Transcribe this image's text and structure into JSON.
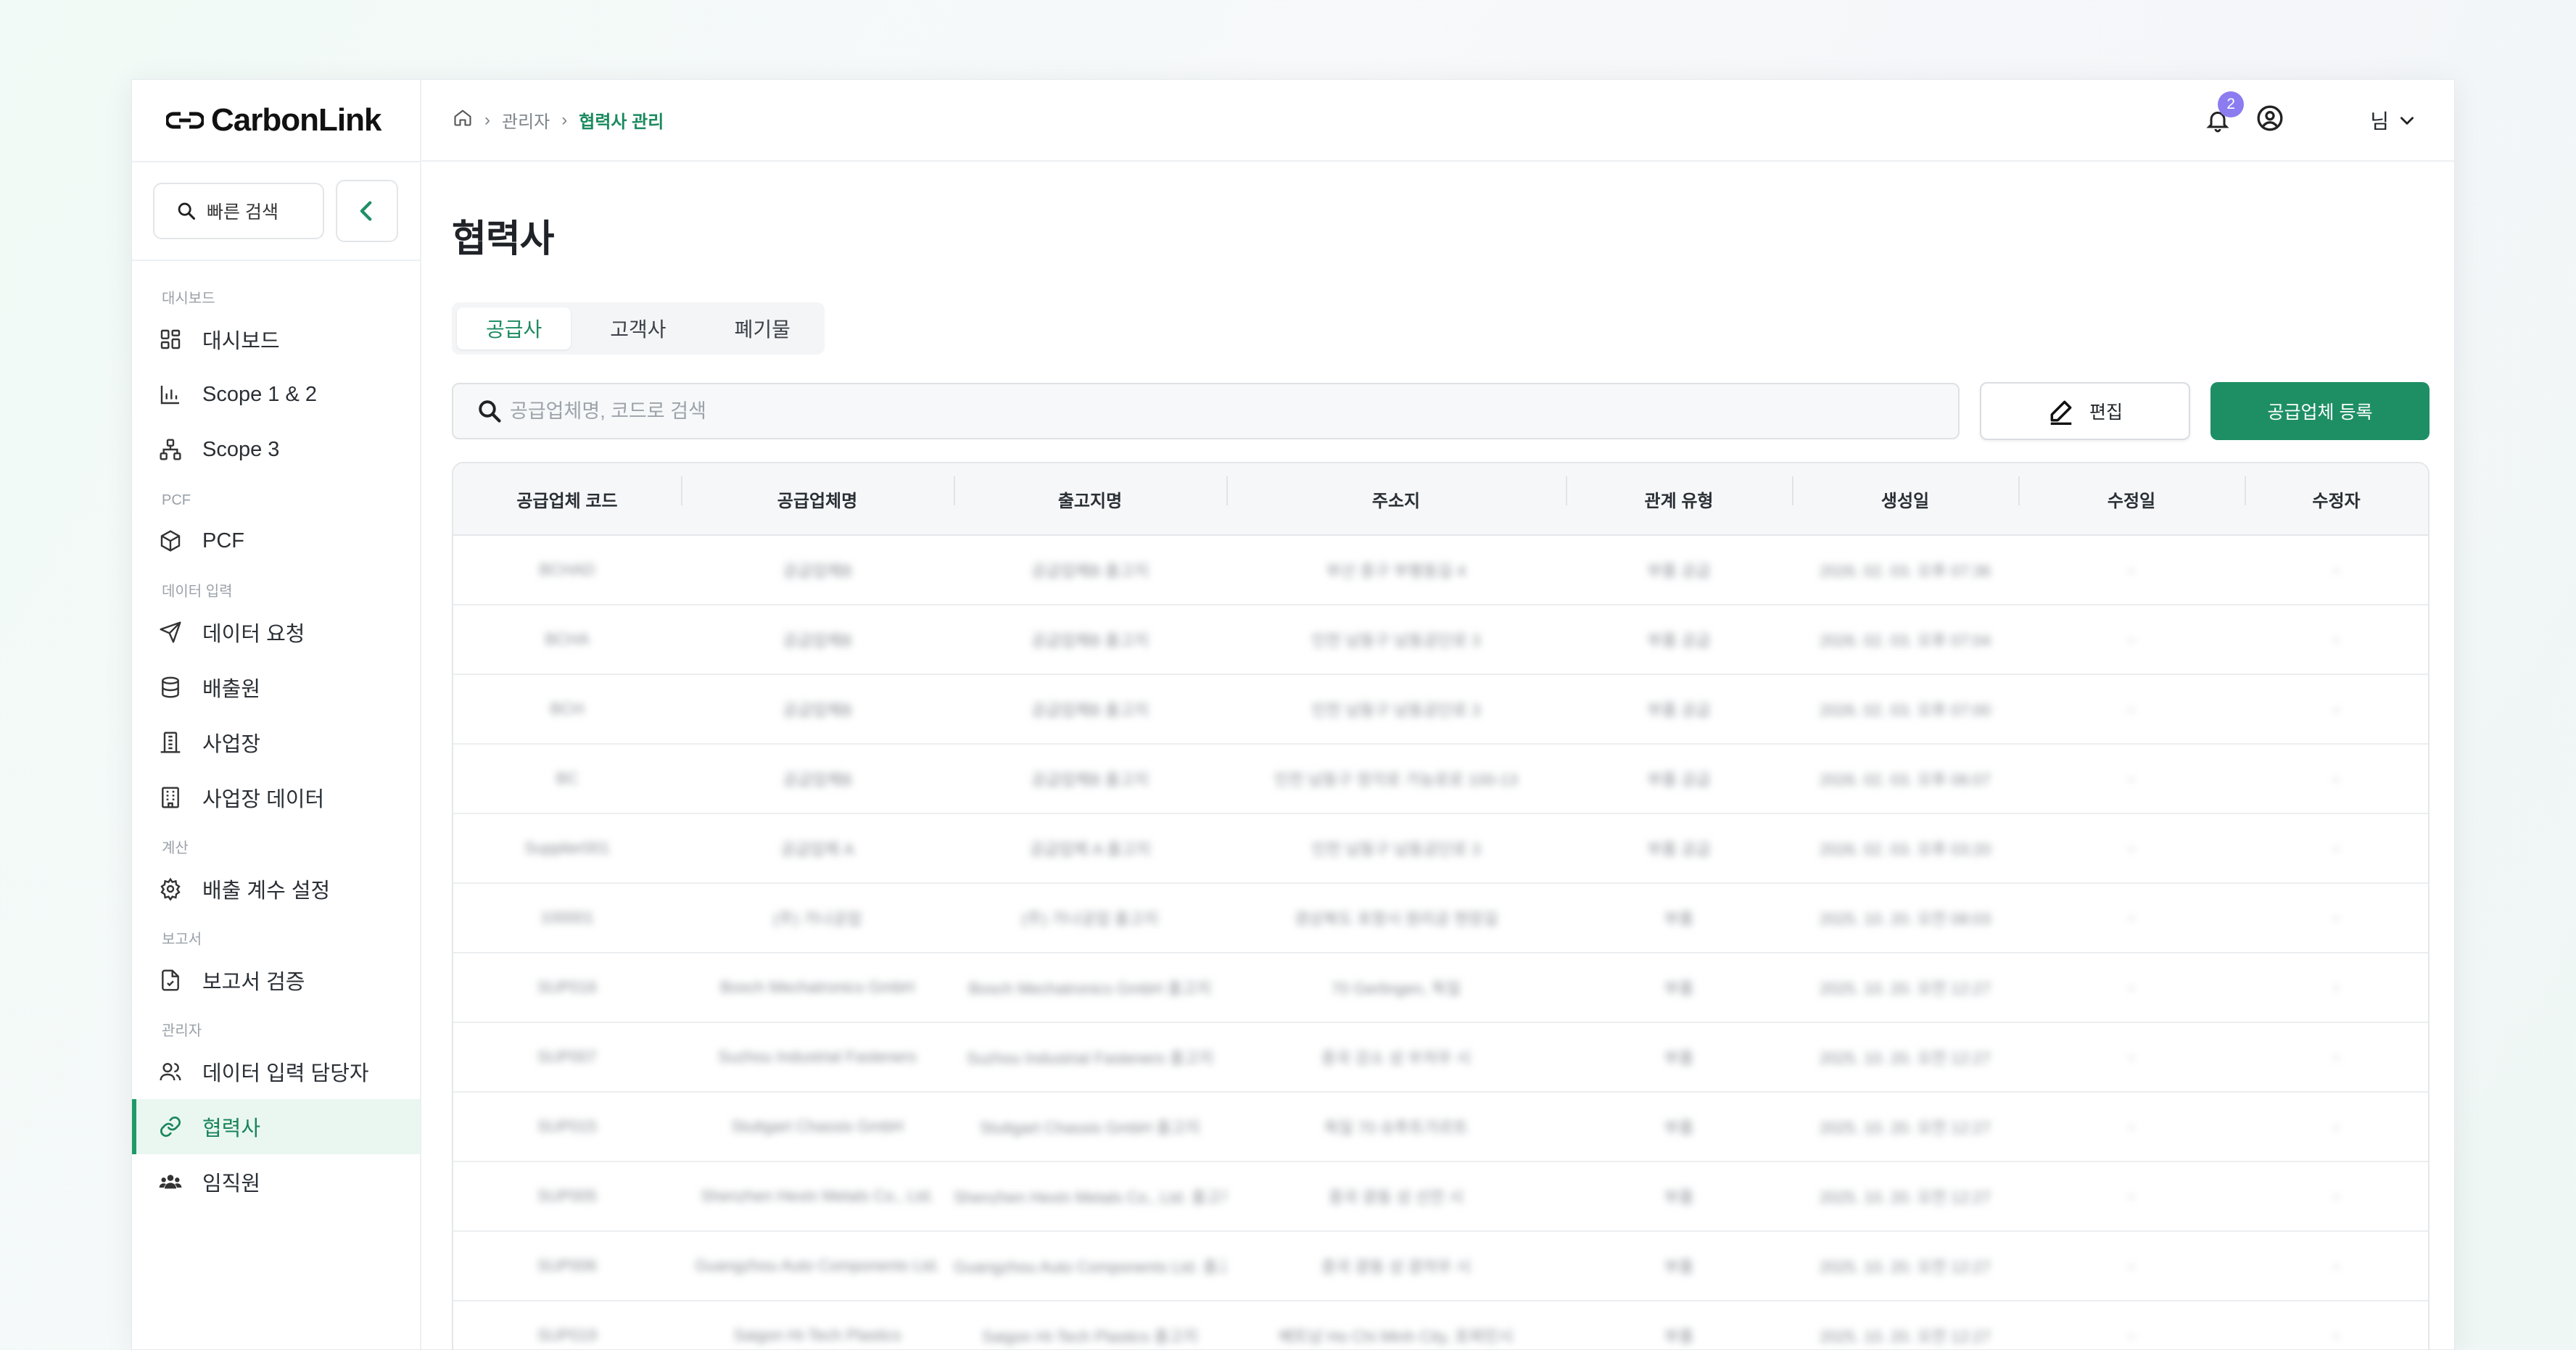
{
  "app": {
    "logo_text": "CarbonLink"
  },
  "sidebar": {
    "quick_search": "빠른 검색",
    "sections": [
      {
        "label": "대시보드",
        "items": [
          {
            "label": "대시보드",
            "icon": "grid-icon"
          },
          {
            "label": "Scope 1 & 2",
            "icon": "bar-chart-icon"
          },
          {
            "label": "Scope 3",
            "icon": "network-icon"
          }
        ]
      },
      {
        "label": "PCF",
        "items": [
          {
            "label": "PCF",
            "icon": "cube-icon"
          }
        ]
      },
      {
        "label": "데이터 입력",
        "items": [
          {
            "label": "데이터 요청",
            "icon": "send-icon"
          },
          {
            "label": "배출원",
            "icon": "database-icon"
          },
          {
            "label": "사업장",
            "icon": "factory-icon"
          },
          {
            "label": "사업장 데이터",
            "icon": "building-icon"
          }
        ]
      },
      {
        "label": "계산",
        "items": [
          {
            "label": "배출 계수 설정",
            "icon": "gear-icon"
          }
        ]
      },
      {
        "label": "보고서",
        "items": [
          {
            "label": "보고서 검증",
            "icon": "document-check-icon"
          }
        ]
      },
      {
        "label": "관리자",
        "items": [
          {
            "label": "데이터 입력 담당자",
            "icon": "users-icon"
          },
          {
            "label": "협력사",
            "icon": "link-icon",
            "active": true
          },
          {
            "label": "임직원",
            "icon": "team-icon"
          }
        ]
      }
    ]
  },
  "breadcrumb": {
    "level1": "관리자",
    "current": "협력사 관리"
  },
  "header": {
    "notification_count": "2",
    "user_name": "님"
  },
  "page": {
    "title": "협력사"
  },
  "tabs": [
    {
      "label": "공급사",
      "active": true
    },
    {
      "label": "고객사"
    },
    {
      "label": "폐기물"
    }
  ],
  "toolbar": {
    "search_placeholder": "공급업체명, 코드로 검색",
    "edit_label": "편집",
    "register_label": "공급업체 등록"
  },
  "table": {
    "columns": [
      "공급업체 코드",
      "공급업체명",
      "출고지명",
      "주소지",
      "관계 유형",
      "생성일",
      "수정일",
      "수정자"
    ],
    "rows": [
      [
        "BCHAD",
        "공급업체B",
        "공급업체B 출고지",
        "부산 중구 부평동길 4",
        "부품 공급",
        "2026. 02. 03. 오후 07:36",
        "-",
        "-"
      ],
      [
        "BCHA",
        "공급업체B",
        "공급업체B 출고지",
        "인천 남동구 남동공단로 3",
        "부품 공급",
        "2026. 02. 03. 오후 07:04",
        "-",
        "-"
      ],
      [
        "BCH",
        "공급업체B",
        "공급업체B 출고지",
        "인천 남동구 남동공단로 3",
        "부품 공급",
        "2026. 02. 03. 오후 07:00",
        "-",
        "-"
      ],
      [
        "BC",
        "공급업체B",
        "공급업체B 출고지",
        "인천 남동구 정각로 가능로로 100-13",
        "부품 공급",
        "2026. 02. 03. 오후 06:07",
        "-",
        "-"
      ],
      [
        "Supplier001",
        "공급업체 A",
        "공급업체 A 출고지",
        "인천 남동구 남동공단로 3",
        "부품 공급",
        "2026. 02. 03. 오후 03:20",
        "-",
        "-"
      ],
      [
        "100001",
        "(주) 가나공업",
        "(주) 가나공업 출고지",
        "경상북도 포항시 원리공 현장길",
        "부품",
        "2025. 10. 20. 오전 08:03",
        "-",
        "-"
      ],
      [
        "SUP016",
        "Bosch Mechatronics GmbH",
        "Bosch Mechatronics GmbH 출고지",
        "70 Gerlingen, 독일",
        "부품",
        "2025. 10. 20. 오전 12:27",
        "-",
        "-"
      ],
      [
        "SUP007",
        "Suzhou Industrial Fasteners",
        "Suzhou Industrial Fasteners 출고지",
        "중국 강소 성 쑤저우 시",
        "부품",
        "2025. 10. 20. 오전 12:27",
        "-",
        "-"
      ],
      [
        "SUP015",
        "Stuttgart Chassis GmbH",
        "Stuttgart Chassis GmbH 출고지",
        "독일 70 슈투트가르트",
        "부품",
        "2025. 10. 20. 오전 12:27",
        "-",
        "-"
      ],
      [
        "SUP005",
        "Shenzhen Hexin Metals Co., Ltd.",
        "Shenzhen Hexin Metals Co., Ltd. 출고지",
        "중국 광동 성 선전 시",
        "부품",
        "2025. 10. 20. 오전 12:27",
        "-",
        "-"
      ],
      [
        "SUP006",
        "Guangzhou Auto Components Ltd.",
        "Guangzhou Auto Components Ltd. 출고지",
        "중국 광동 성 광저우 시",
        "부품",
        "2025. 10. 20. 오전 12:27",
        "-",
        "-"
      ],
      [
        "SUP019",
        "Saigon Hi-Tech Plastics",
        "Saigon Hi-Tech Plastics 출고지",
        "베트남 Ho Chi Minh City, 호찌민시",
        "부품",
        "2025. 10. 20. 오전 12:27",
        "-",
        "-"
      ]
    ]
  },
  "colors": {
    "accent": "#1e8f65",
    "badge": "#8b7cf0",
    "active_bg": "#eaf7f1"
  }
}
